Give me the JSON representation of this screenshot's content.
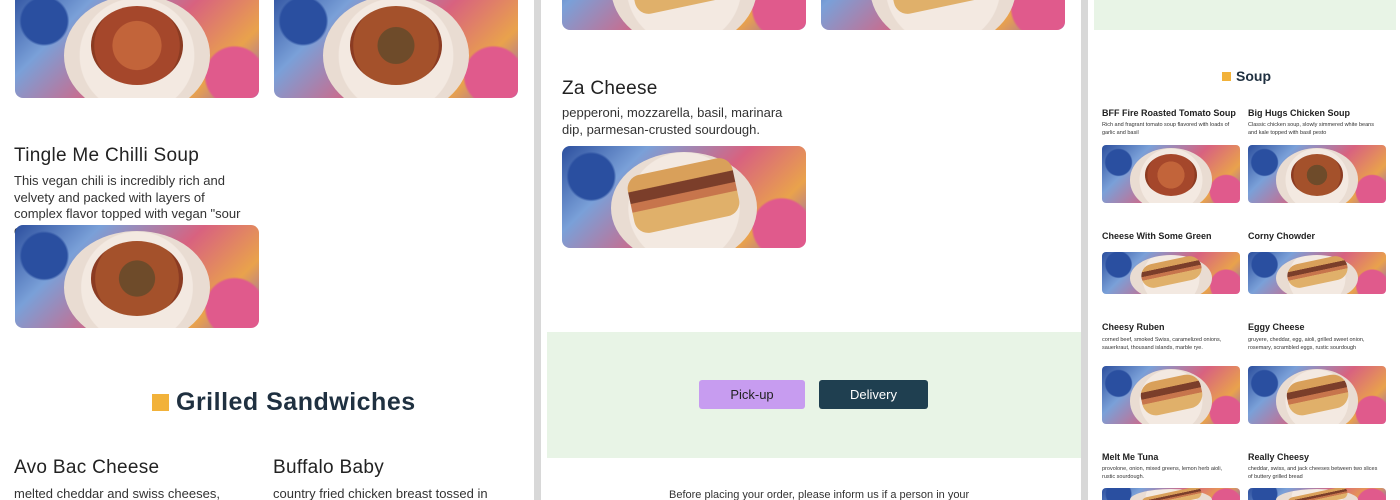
{
  "panel_left": {
    "chilli": {
      "title": "Tingle Me Chilli Soup",
      "desc": "This vegan chili is incredibly rich and velvety and packed with layers of complex flavor topped with vegan \"sour cream\", scallions and"
    },
    "section": {
      "title": "Grilled Sandwiches"
    },
    "avo": {
      "title": "Avo Bac Cheese",
      "desc": "melted cheddar and swiss cheeses, crispy"
    },
    "buffalo": {
      "title": "Buffalo Baby",
      "desc": "country fried chicken breast tossed in buffalo"
    }
  },
  "panel_middle": {
    "za": {
      "title": "Za Cheese",
      "desc": "pepperoni, mozzarella, basil, marinara dip, parmesan-crusted sourdough."
    },
    "order": {
      "pickup_label": "Pick-up",
      "delivery_label": "Delivery",
      "note": "Before placing your order, please inform us if a person in your"
    },
    "colors": {
      "pickup_bg": "#c79cf0",
      "delivery_bg": "#1f3f50",
      "band_bg": "#e8f4e6"
    }
  },
  "panel_right": {
    "section": {
      "title": "Soup"
    },
    "cards": [
      {
        "title": "BFF Fire Roasted Tomato Soup",
        "desc": "Rich and fragrant tomato soup flavored with loads of garlic and basil"
      },
      {
        "title": "Big Hugs Chicken Soup",
        "desc": "Classic chicken soup, slowly simmered white beans and kale topped with basil pesto"
      },
      {
        "title": "Cheese With Some Green",
        "desc": ""
      },
      {
        "title": "Corny Chowder",
        "desc": ""
      },
      {
        "title": "Cheesy Ruben",
        "desc": "corned beef, smoked Swiss, caramelized onions, sauerkraut, thousand islands, marble rye."
      },
      {
        "title": "Eggy Cheese",
        "desc": "gruyere, cheddar, egg, aioli, grilled sweet onion, rosemary, scrambled eggs, rustic sourdough"
      },
      {
        "title": "Melt Me Tuna",
        "desc": "provolone, onion, mixed greens, lemon herb aioli, rustic sourdough."
      },
      {
        "title": "Really Cheesy",
        "desc": "cheddar, swiss, and jack cheeses between two slices of buttery grilled bread"
      }
    ]
  }
}
